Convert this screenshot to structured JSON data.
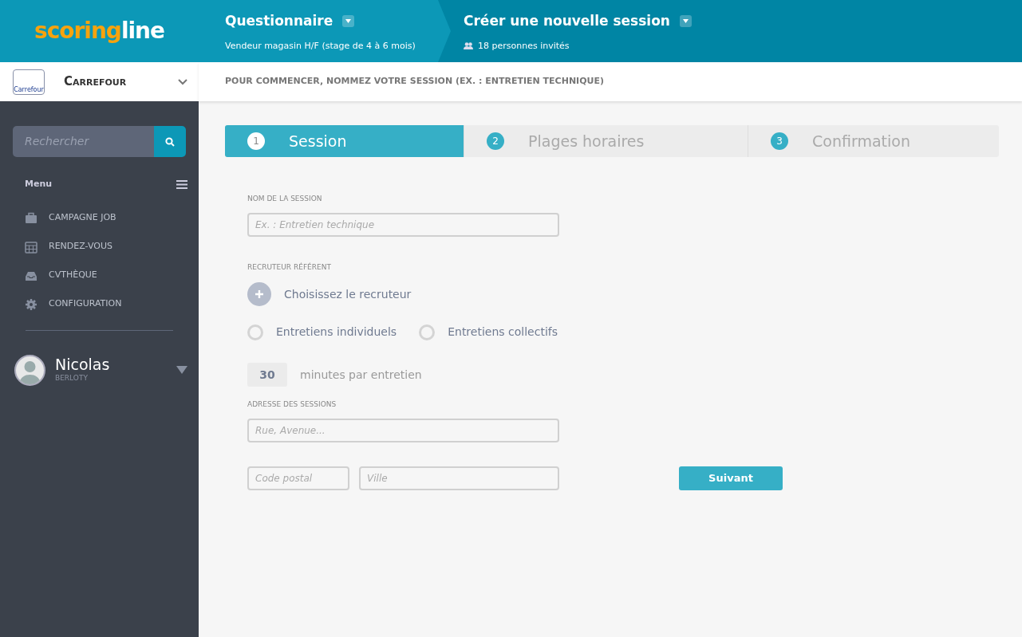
{
  "logo": {
    "part_1": "scoring",
    "part_2": "line"
  },
  "breadcrumbs": [
    {
      "title": "Questionnaire",
      "subtitle": "Vendeur magasin H/F (stage de 4 à 6 mois)",
      "kind": "plain"
    },
    {
      "title": "Créer une nouvelle session",
      "subtitle": "18 personnes invités",
      "kind": "people"
    }
  ],
  "company": {
    "name": "CARREFOUR",
    "logo_text": "Carrefour"
  },
  "instruction": "POUR COMMENCER, NOMMEZ VOTRE SESSION (EX. : ENTRETIEN TECHNIQUE)",
  "sidebar": {
    "search": {
      "placeholder": "Rechercher"
    },
    "menu_title": "Menu",
    "items": [
      {
        "label": "CAMPAGNE JOB"
      },
      {
        "label": "RENDEZ-VOUS"
      },
      {
        "label": "CVTHÈQUE"
      },
      {
        "label": "CONFIGURATION"
      }
    ],
    "user": {
      "first_name": "Nicolas",
      "last_name": "BERLOTY"
    }
  },
  "steps": [
    {
      "number": "1",
      "label": "Session",
      "selected": true
    },
    {
      "number": "2",
      "label": "Plages horaires",
      "selected": false
    },
    {
      "number": "3",
      "label": "Confirmation",
      "selected": false
    }
  ],
  "form": {
    "name_label": "NOM DE LA SESSION",
    "name_placeholder": "Ex. : Entretien technique",
    "recruiter_label": "RECRUTEUR RÉFÉRENT",
    "recruiter_action": "Choisissez le recruteur",
    "interview_types": [
      {
        "label": "Entretiens individuels",
        "checked": false
      },
      {
        "label": "Entretiens collectifs",
        "checked": false
      }
    ],
    "duration": "30",
    "duration_unit": "minutes par entretien",
    "address_label": "ADRESSE DES SESSIONS",
    "street_placeholder": "Rue, Avenue...",
    "postal_placeholder": "Code postal",
    "city_placeholder": "Ville",
    "next_button": "Suivant"
  }
}
